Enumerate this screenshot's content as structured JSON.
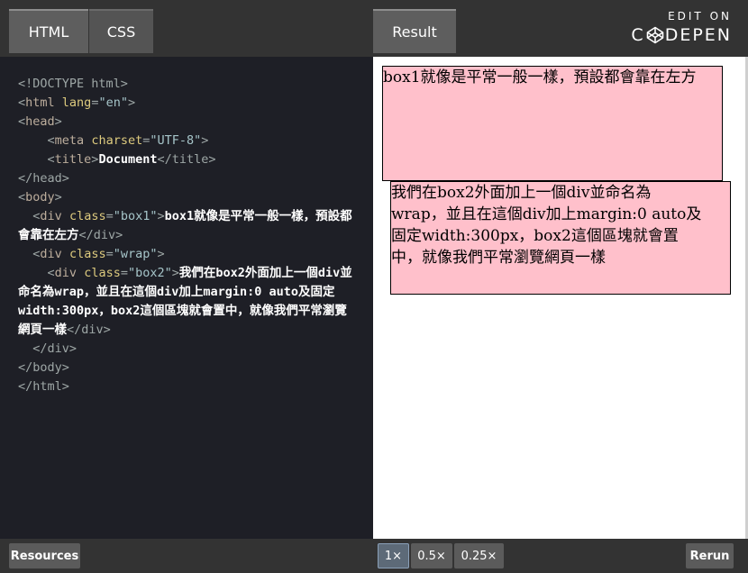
{
  "tabs": {
    "html": "HTML",
    "css": "CSS",
    "result": "Result"
  },
  "branding": {
    "edit_on": "EDIT ON",
    "codepen_c": "C",
    "codepen_rest": "DEPEN"
  },
  "code": {
    "lines": [
      {
        "doctype": "<!DOCTYPE html>"
      },
      {
        "open": "<",
        "tag": "html",
        "attr": "lang",
        "eq": "=",
        "val": "\"en\"",
        "close": ">"
      },
      {
        "open": "<",
        "tag": "head",
        "close": ">"
      },
      {
        "open": "<",
        "tag": "meta",
        "attr": "charset",
        "eq": "=",
        "val": "\"UTF-8\"",
        "close": ">"
      },
      {
        "open": "<",
        "tag": "title",
        "close": ">",
        "text": "Document",
        "end": "</title>"
      },
      {
        "end": "</head>"
      },
      {
        "open": "<",
        "tag": "body",
        "close": ">"
      },
      {
        "open": "<",
        "tag": "div",
        "attr": "class",
        "eq": "=",
        "val": "\"box1\"",
        "close": ">",
        "text": "box1就像是平常一般一樣，預設都會靠在左方",
        "end": "</div>"
      },
      {
        "open": "<",
        "tag": "div",
        "attr": "class",
        "eq": "=",
        "val": "\"wrap\"",
        "close": ">"
      },
      {
        "open": "<",
        "tag": "div",
        "attr": "class",
        "eq": "=",
        "val": "\"box2\"",
        "close": ">",
        "text": "我們在box2外面加上一個div並命名為wrap，並且在這個div加上margin:0 auto及固定width:300px，box2這個區塊就會置中，就像我們平常瀏覽網頁一樣",
        "end": "</div>"
      },
      {
        "end": "</div>"
      },
      {
        "end": "</body>"
      },
      {
        "end": "</html>"
      }
    ]
  },
  "result": {
    "box1_text": "box1就像是平常一般一樣，預設都會靠在左方",
    "box2_text": "我們在box2外面加上一個div並命名為wrap，並且在這個div加上margin:0 auto及固定width:300px，box2這個區塊就會置中，就像我們平常瀏覽網頁一樣"
  },
  "bottom": {
    "resources": "Resources",
    "zoom_1": "1×",
    "zoom_05": "0.5×",
    "zoom_025": "0.25×",
    "rerun": "Rerun"
  },
  "colors": {
    "box_bg": "#ffc0cb",
    "editor_bg": "#1e1f26",
    "bar_bg": "#333333"
  }
}
